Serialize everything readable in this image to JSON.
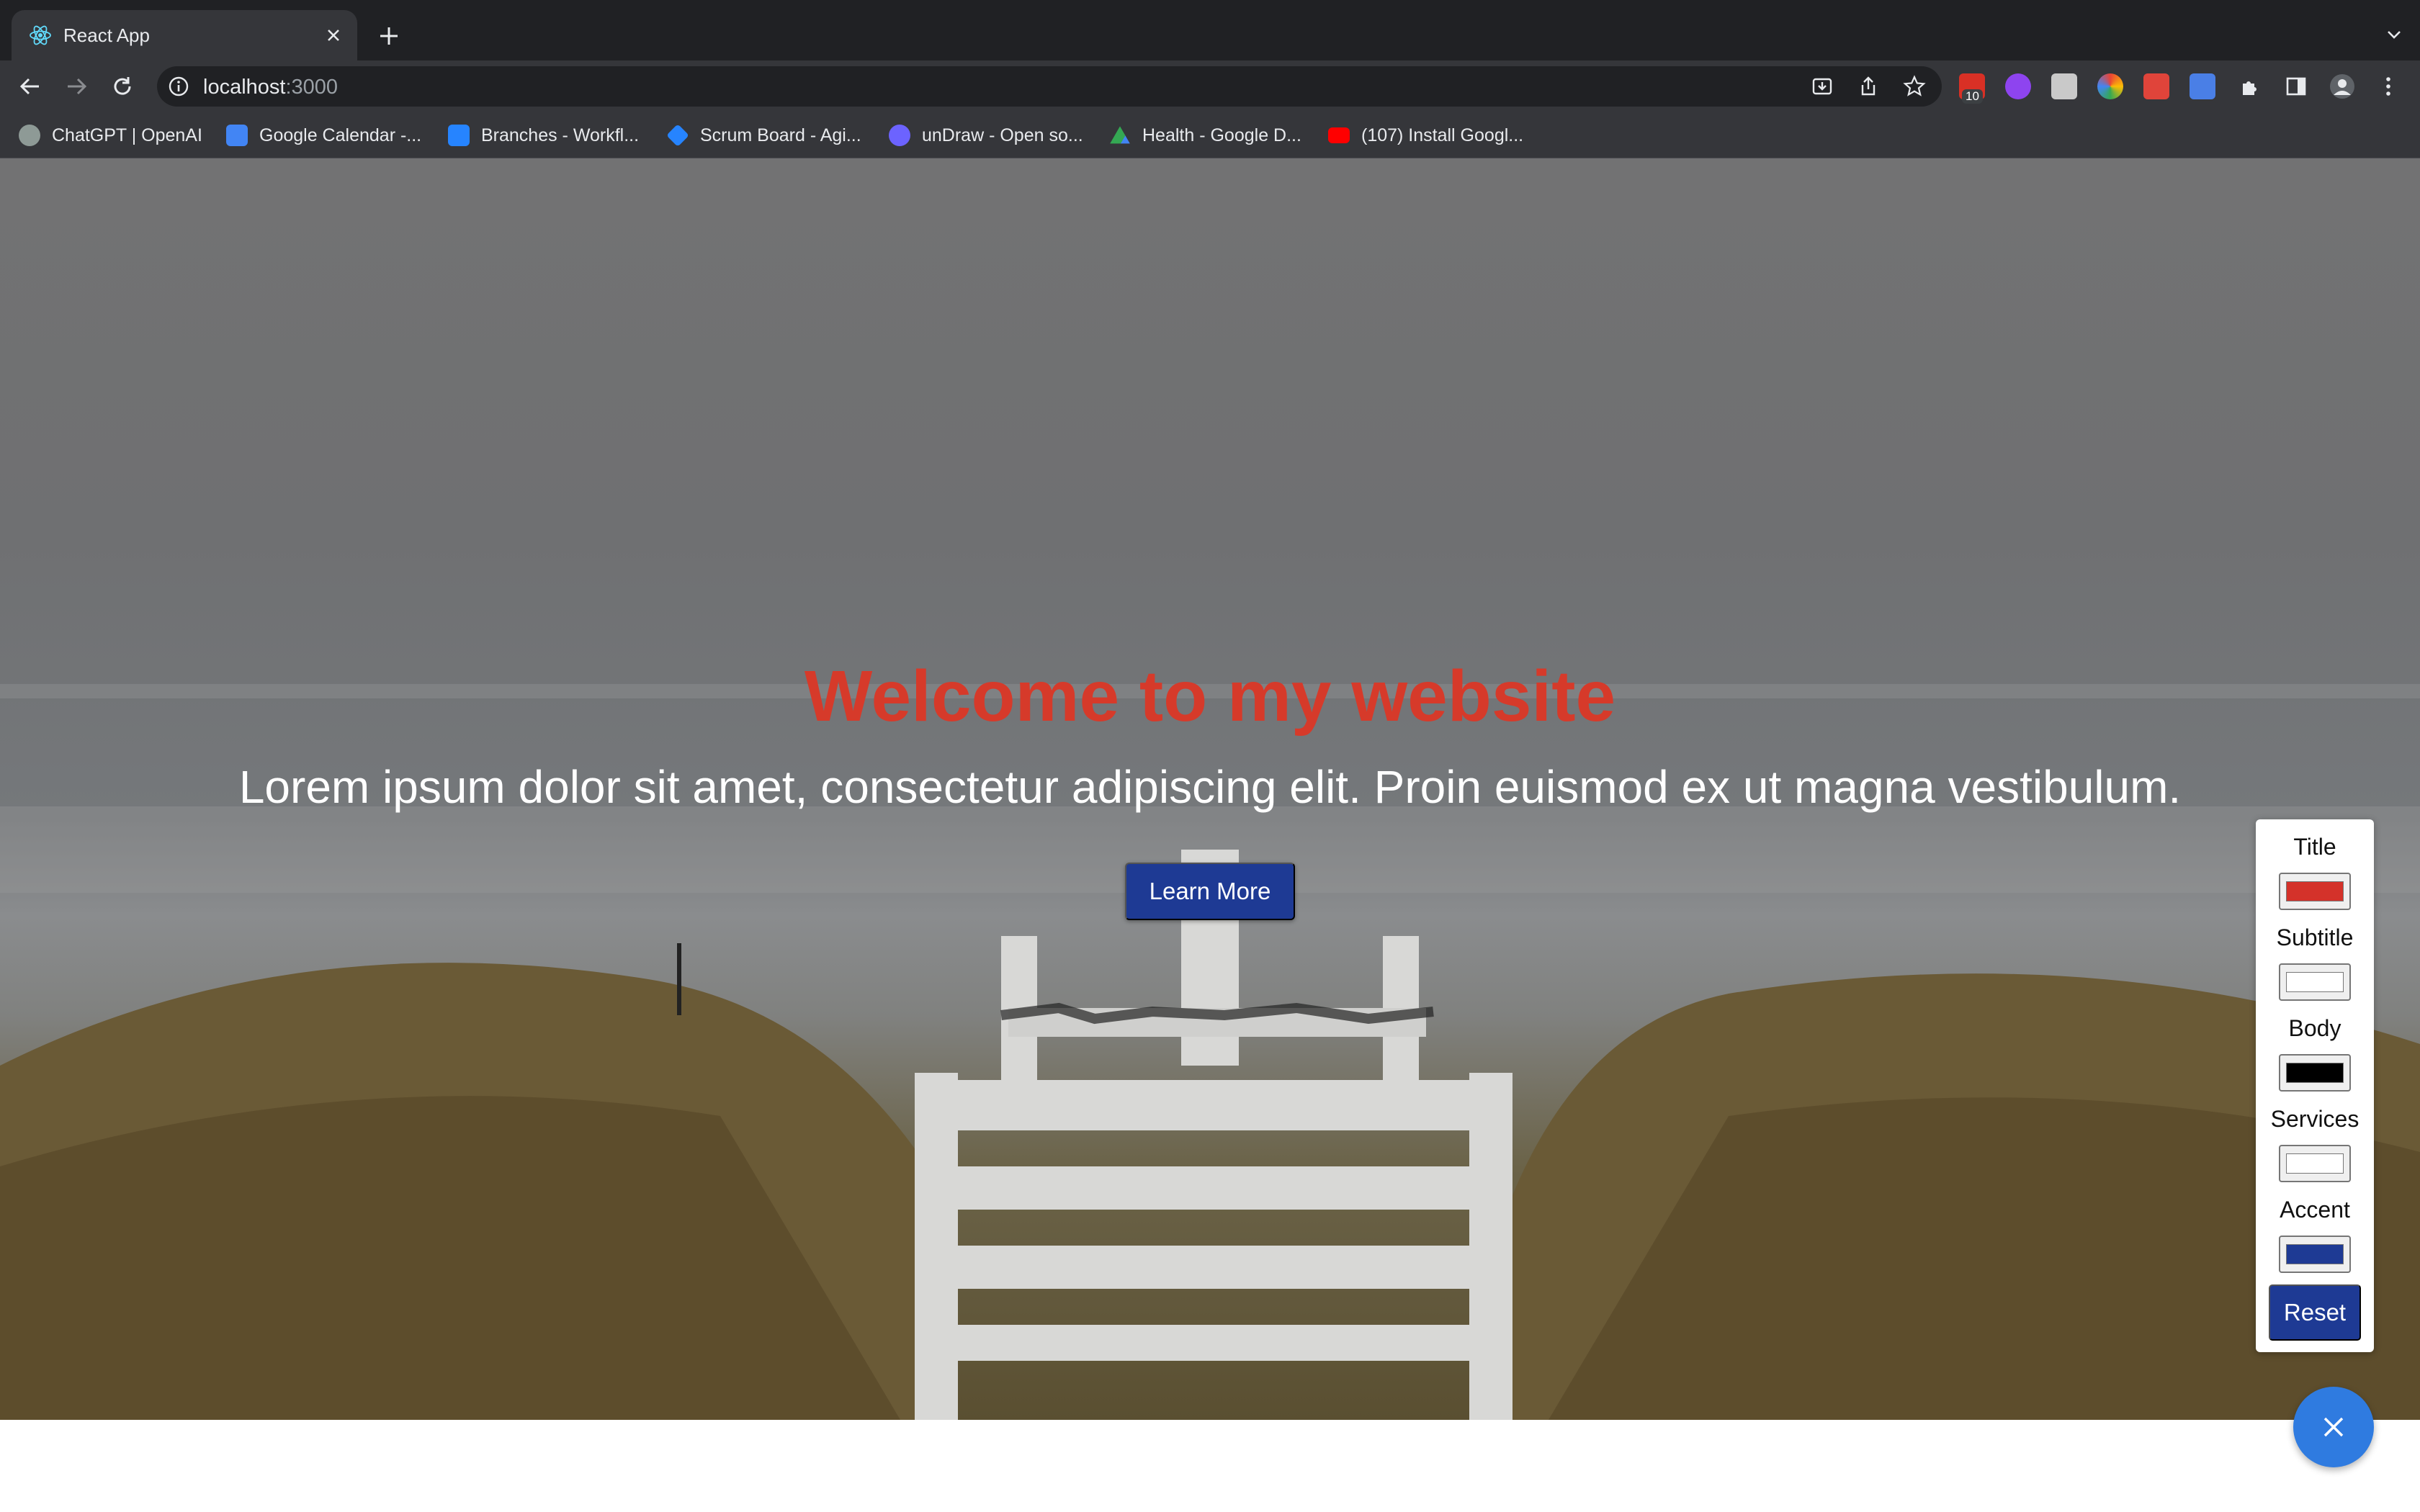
{
  "browser": {
    "tab": {
      "title": "React App",
      "favicon": "react-logo-icon"
    },
    "url": {
      "host": "localhost",
      "port": ":3000"
    },
    "extensions": {
      "badge_count": "10"
    },
    "bookmarks": [
      {
        "label": "ChatGPT | OpenAI",
        "icon": "openai-icon",
        "color": "#8e9a96"
      },
      {
        "label": "Google Calendar -...",
        "icon": "calendar-icon",
        "color": "#4285f4"
      },
      {
        "label": "Branches - Workfl...",
        "icon": "bitbucket-icon",
        "color": "#2684ff"
      },
      {
        "label": "Scrum Board - Agi...",
        "icon": "jira-icon",
        "color": "#2684ff"
      },
      {
        "label": "unDraw - Open so...",
        "icon": "undraw-icon",
        "color": "#6c63ff"
      },
      {
        "label": "Health - Google D...",
        "icon": "google-drive-icon",
        "color": "#34a853"
      },
      {
        "label": "(107) Install Googl...",
        "icon": "youtube-icon",
        "color": "#ff0000"
      }
    ]
  },
  "hero": {
    "title": "Welcome to my website",
    "subtitle": "Lorem ipsum dolor sit amet, consectetur adipiscing elit. Proin euismod ex ut magna vestibulum.",
    "button_label": "Learn More"
  },
  "color_panel": {
    "fields": [
      {
        "label": "Title",
        "color": "#d4322a"
      },
      {
        "label": "Subtitle",
        "color": "#ffffff"
      },
      {
        "label": "Body",
        "color": "#000000"
      },
      {
        "label": "Services",
        "color": "#ffffff"
      },
      {
        "label": "Accent",
        "color": "#1e3a94"
      }
    ],
    "reset_label": "Reset"
  },
  "fab": {
    "icon": "close-icon"
  }
}
